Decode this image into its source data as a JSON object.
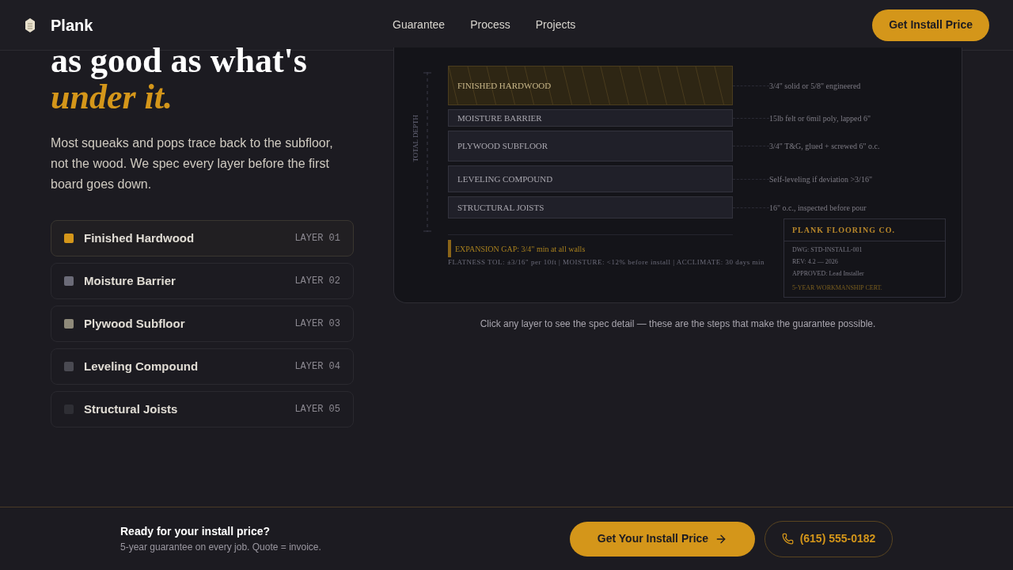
{
  "header": {
    "brand": "Plank",
    "nav": [
      "Guarantee",
      "Process",
      "Projects"
    ],
    "cta": "Get Install Price"
  },
  "hero": {
    "headline": "as good as what's",
    "headline_accent": "under it.",
    "body": "Most squeaks and pops trace back to the subfloor, not the wood. We spec every layer before the first board goes down."
  },
  "layers": [
    {
      "name": "Finished Hardwood",
      "tag": "LAYER 01",
      "color": "#d4961a",
      "selected": true,
      "diagram_label": "FINISHED HARDWOOD",
      "spec": "3/4\" solid or 5/8\" engineered"
    },
    {
      "name": "Moisture Barrier",
      "tag": "LAYER 02",
      "color": "#6b6b78",
      "selected": false,
      "diagram_label": "MOISTURE BARRIER",
      "spec": "15lb felt or 6mil poly, lapped 6\""
    },
    {
      "name": "Plywood Subfloor",
      "tag": "LAYER 03",
      "color": "#8f8a7a",
      "selected": false,
      "diagram_label": "PLYWOOD SUBFLOOR",
      "spec": "3/4\" T&G, glued + screwed 6\" o.c."
    },
    {
      "name": "Leveling Compound",
      "tag": "LAYER 04",
      "color": "#4a4a52",
      "selected": false,
      "diagram_label": "LEVELING COMPOUND",
      "spec": "Self-leveling if deviation >3/16\""
    },
    {
      "name": "Structural Joists",
      "tag": "LAYER 05",
      "color": "#2e2e34",
      "selected": false,
      "diagram_label": "STRUCTURAL JOISTS",
      "spec": "16\" o.c., inspected before pour"
    }
  ],
  "diagram": {
    "depth_label": "TOTAL DEPTH",
    "expansion_note": "EXPANSION GAP: 3/4\" min at all walls",
    "tolerance_note": "FLATNESS TOL: ±3/16\" per 10ft | MOISTURE: <12% before install | ACCLIMATE: 30 days min",
    "title_block": {
      "company": "PLANK FLOORING CO.",
      "lines": [
        "DWG: STD-INSTALL-001",
        "REV: 4.2 — 2026",
        "APPROVED: Lead Installer"
      ],
      "cert": "5-YEAR WORKMANSHIP CERT."
    }
  },
  "caption": "Click any layer to see the spec detail — these are the steps that make the guarantee possible.",
  "footer": {
    "title": "Ready for your install price?",
    "subtitle": "5-year guarantee on every job. Quote = invoice.",
    "cta": "Get Your Install Price",
    "phone": "(615) 555-0182"
  }
}
